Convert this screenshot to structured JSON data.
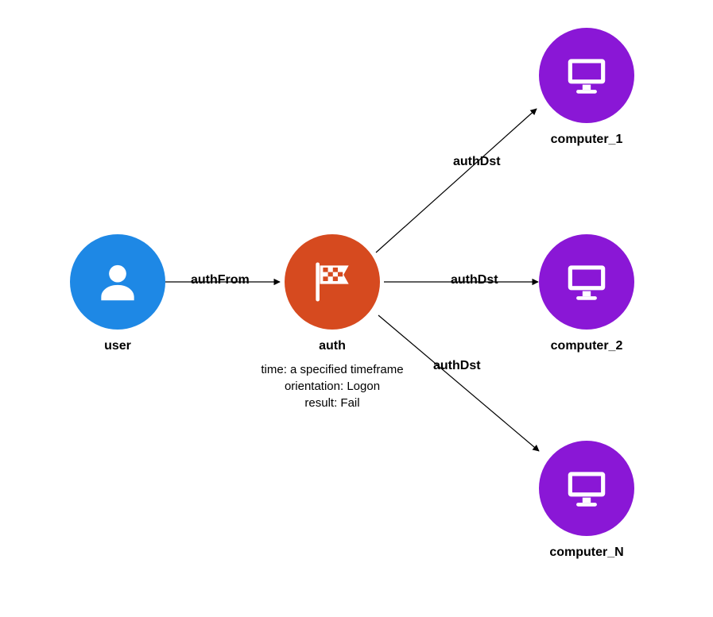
{
  "nodes": {
    "user": {
      "label": "user",
      "color": "#1e88e5",
      "icon": "person"
    },
    "auth": {
      "label": "auth",
      "color": "#d64a1f",
      "icon": "flag",
      "meta_time": "time: a specified timeframe",
      "meta_orientation": "orientation: Logon",
      "meta_result": "result: Fail"
    },
    "computer_1": {
      "label": "computer_1",
      "color": "#8a17d6",
      "icon": "monitor"
    },
    "computer_2": {
      "label": "computer_2",
      "color": "#8a17d6",
      "icon": "monitor"
    },
    "computer_N": {
      "label": "computer_N",
      "color": "#8a17d6",
      "icon": "monitor"
    }
  },
  "edges": [
    {
      "from": "user",
      "to": "auth",
      "label": "authFrom"
    },
    {
      "from": "auth",
      "to": "computer_1",
      "label": "authDst"
    },
    {
      "from": "auth",
      "to": "computer_2",
      "label": "authDst"
    },
    {
      "from": "auth",
      "to": "computer_N",
      "label": "authDst"
    }
  ]
}
